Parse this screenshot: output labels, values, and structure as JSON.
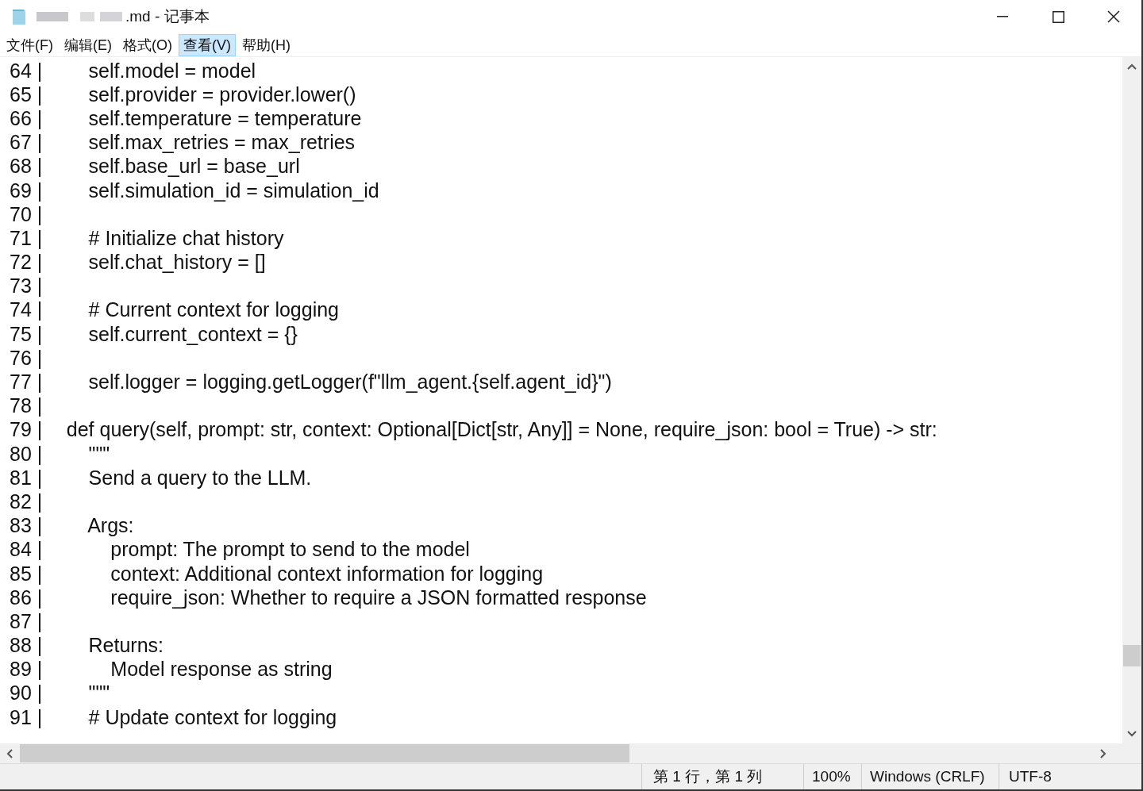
{
  "window": {
    "title": ".md - 记事本"
  },
  "menu": [
    {
      "label": "文件(F)",
      "selected": false
    },
    {
      "label": "编辑(E)",
      "selected": false
    },
    {
      "label": "格式(O)",
      "selected": false
    },
    {
      "label": "查看(V)",
      "selected": true
    },
    {
      "label": "帮助(H)",
      "selected": false
    }
  ],
  "editor": {
    "lines": [
      {
        "number": "64 |",
        "text": "        self.model = model"
      },
      {
        "number": "65 |",
        "text": "        self.provider = provider.lower()"
      },
      {
        "number": "66 |",
        "text": "        self.temperature = temperature"
      },
      {
        "number": "67 |",
        "text": "        self.max_retries = max_retries"
      },
      {
        "number": "68 |",
        "text": "        self.base_url = base_url"
      },
      {
        "number": "69 |",
        "text": "        self.simulation_id = simulation_id"
      },
      {
        "number": "70 |"
      },
      {
        "number": "71 |",
        "text": "        # Initialize chat history"
      },
      {
        "number": "72 |",
        "text": "        self.chat_history = []"
      },
      {
        "number": "73 |"
      },
      {
        "number": "74 |",
        "text": "        # Current context for logging"
      },
      {
        "number": "75 |",
        "text": "        self.current_context = {}"
      },
      {
        "number": "76 |"
      },
      {
        "number": "77 |",
        "text": "        self.logger = logging.getLogger(f\"llm_agent.{self.agent_id}\")"
      },
      {
        "number": "78 |"
      },
      {
        "number": "79 |",
        "text": "    def query(self, prompt: str, context: Optional[Dict[str, Any]] = None, require_json: bool = True) -> str:"
      },
      {
        "number": "80 |",
        "text": "        \"\"\""
      },
      {
        "number": "81 |",
        "text": "        Send a query to the LLM."
      },
      {
        "number": "82 |"
      },
      {
        "number": "83 |",
        "text": "        Args:"
      },
      {
        "number": "84 |",
        "text": "            prompt: The prompt to send to the model"
      },
      {
        "number": "85 |",
        "text": "            context: Additional context information for logging"
      },
      {
        "number": "86 |",
        "text": "            require_json: Whether to require a JSON formatted response"
      },
      {
        "number": "87 |"
      },
      {
        "number": "88 |",
        "text": "        Returns:"
      },
      {
        "number": "89 |",
        "text": "            Model response as string"
      },
      {
        "number": "90 |",
        "text": "        \"\"\""
      },
      {
        "number": "91 |",
        "text": "        # Update context for logging"
      }
    ]
  },
  "status_bar": {
    "position": "第 1 行，第 1 列",
    "zoom": "100%",
    "line_ending": "Windows (CRLF)",
    "encoding": "UTF-8"
  }
}
